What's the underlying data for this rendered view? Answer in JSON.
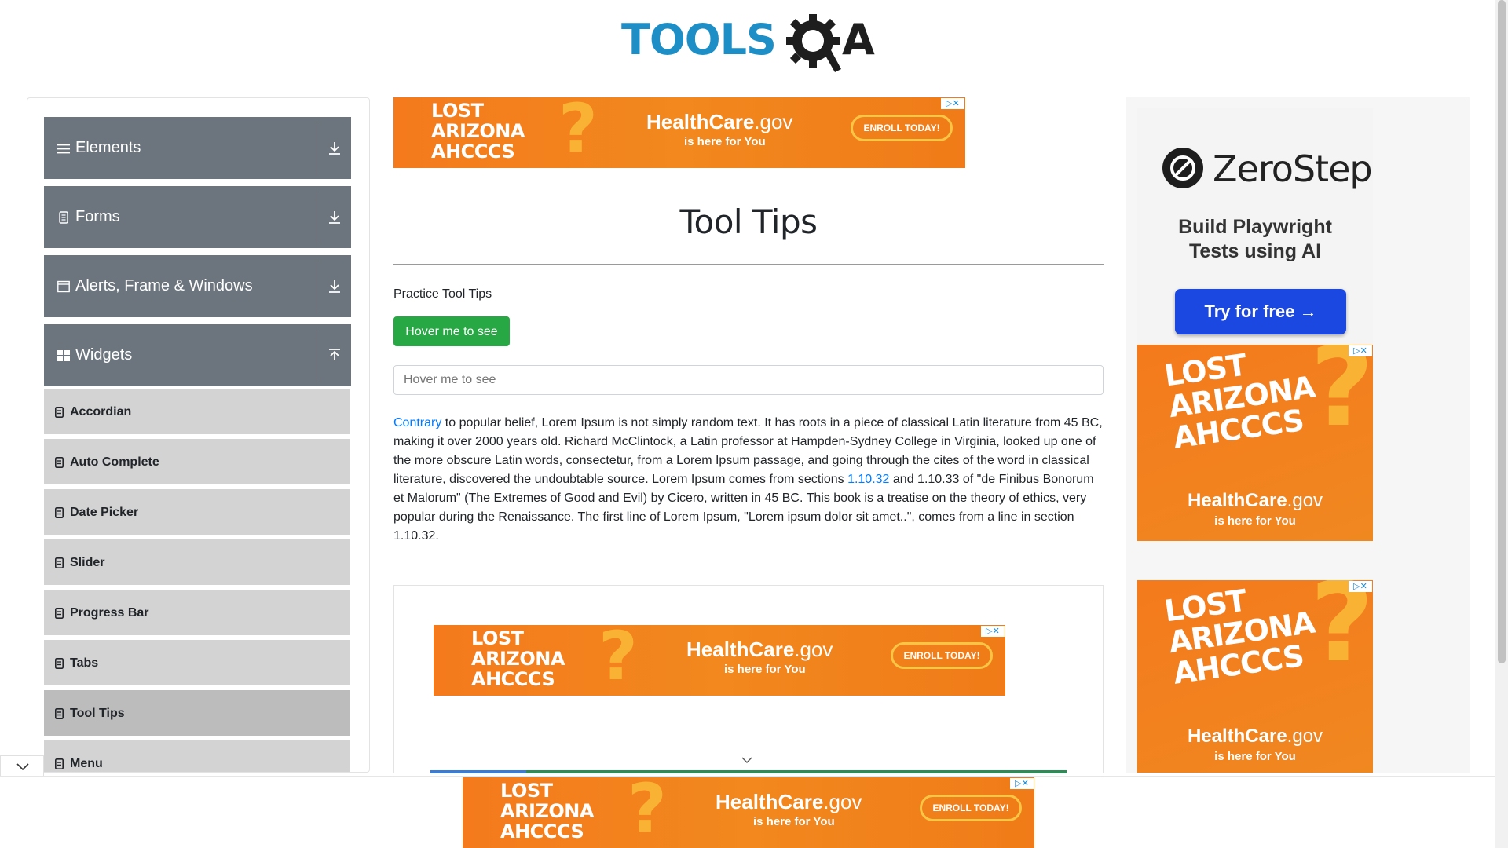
{
  "logo": {
    "word": "TOOLS",
    "letter": "A"
  },
  "sidebar": {
    "groups": [
      {
        "label": "Elements",
        "icon": "hamburger-icon",
        "arrow": "download-icon"
      },
      {
        "label": "Forms",
        "icon": "document-icon",
        "arrow": "download-icon"
      },
      {
        "label": "Alerts, Frame & Windows",
        "icon": "window-icon",
        "arrow": "download-icon"
      },
      {
        "label": "Widgets",
        "icon": "grid-icon",
        "arrow": "upload-icon"
      }
    ],
    "items": [
      {
        "label": "Accordian"
      },
      {
        "label": "Auto Complete"
      },
      {
        "label": "Date Picker"
      },
      {
        "label": "Slider"
      },
      {
        "label": "Progress Bar"
      },
      {
        "label": "Tabs"
      },
      {
        "label": "Tool Tips",
        "active": true
      },
      {
        "label": "Menu"
      }
    ]
  },
  "main": {
    "title": "Tool Tips",
    "practice_label": "Practice Tool Tips",
    "button_label": "Hover me to see",
    "input_placeholder": "Hover me to see",
    "paragraph": {
      "link1": "Contrary",
      "text1": " to popular belief, Lorem Ipsum is not simply random text. It has roots in a piece of classical Latin literature from 45 BC, making it over 2000 years old. Richard McClintock, a Latin professor at Hampden-Sydney College in Virginia, looked up one of the more obscure Latin words, consectetur, from a Lorem Ipsum passage, and going through the cites of the word in classical literature, discovered the undoubtable source. Lorem Ipsum comes from sections ",
      "link2": "1.10.32",
      "text2": " and 1.10.33 of \"de Finibus Bonorum et Malorum\" (The Extremes of Good and Evil) by Cicero, written in 45 BC. This book is a treatise on the theory of ethics, very popular during the Renaissance. The first line of Lorem Ipsum, \"Lorem ipsum dolor sit amet..\", comes from a line in section 1.10.32."
    }
  },
  "ads": {
    "banner": {
      "lost": [
        "LOST",
        "ARIZONA",
        "AHCCCS"
      ],
      "hc_main": "HealthCare",
      "hc_suffix": ".gov",
      "sub": "is here for You",
      "enroll": "ENROLL TODAY!",
      "adchoices": "▷✕"
    },
    "zerostep": {
      "name": "ZeroStep",
      "tagline_line1": "Build Playwright",
      "tagline_line2": "Tests using AI",
      "cta": "Try for free →"
    }
  },
  "colors": {
    "group_bg": "#6c757d",
    "item_bg": "#d3d3d3",
    "button_green": "#28a745",
    "link_blue": "#007bff",
    "ad_orange": "#f47a1c",
    "logo_blue": "#1d8fc6"
  }
}
